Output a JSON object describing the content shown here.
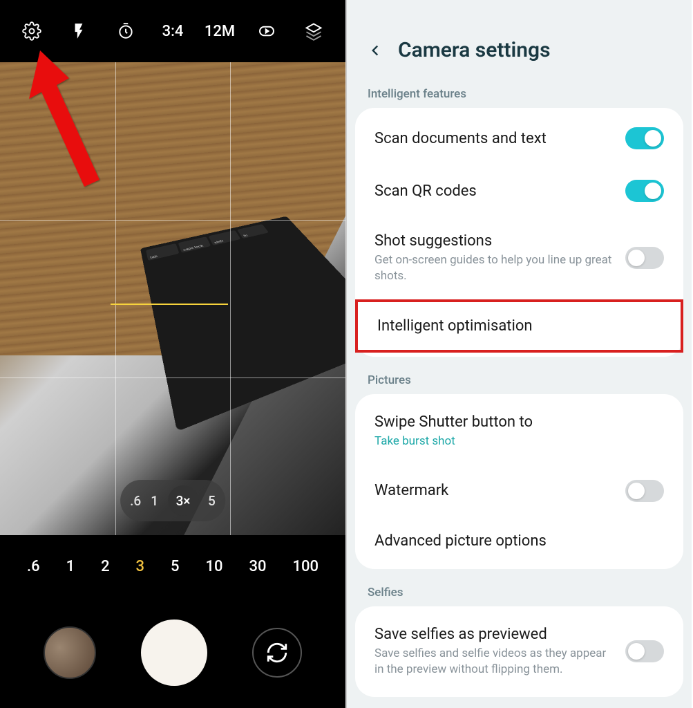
{
  "camera": {
    "topbar": {
      "ratio": "3:4",
      "resolution": "12M"
    },
    "zoomPill": {
      "items": [
        ".6",
        "1",
        "3×",
        "5"
      ],
      "active": 2
    },
    "zoomScale": {
      "items": [
        ".6",
        "1",
        "2",
        "3",
        "5",
        "10",
        "30",
        "100"
      ],
      "active": 3
    },
    "keys": [
      "tab",
      "caps lock",
      "shift",
      "fn"
    ]
  },
  "settings": {
    "title": "Camera settings",
    "sections": [
      {
        "label": "Intelligent features",
        "rows": [
          {
            "title": "Scan documents and text",
            "toggle": "on"
          },
          {
            "title": "Scan QR codes",
            "toggle": "on"
          },
          {
            "title": "Shot suggestions",
            "sub": "Get on-screen guides to help you line up great shots.",
            "toggle": "off"
          },
          {
            "title": "Intelligent optimisation",
            "highlight": true
          }
        ]
      },
      {
        "label": "Pictures",
        "rows": [
          {
            "title": "Swipe Shutter button to",
            "sub": "Take burst shot",
            "subTeal": true
          },
          {
            "title": "Watermark",
            "toggle": "off"
          },
          {
            "title": "Advanced picture options"
          }
        ]
      },
      {
        "label": "Selfies",
        "rows": [
          {
            "title": "Save selfies as previewed",
            "sub": "Save selfies and selfie videos as they appear in the preview without flipping them.",
            "toggle": "off"
          }
        ]
      }
    ]
  }
}
